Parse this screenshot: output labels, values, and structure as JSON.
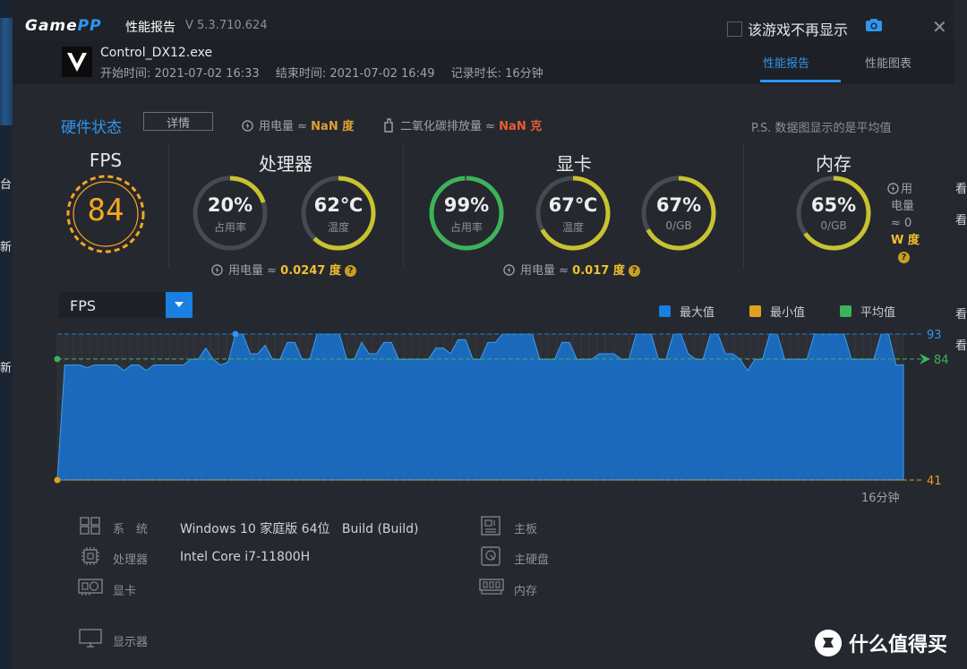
{
  "app": {
    "logo_game": "Game",
    "logo_pp": "PP",
    "title": "性能报告",
    "version": "V 5.3.710.624",
    "no_display_label": "该游戏不再显示",
    "close_glyph": "✕"
  },
  "session": {
    "exe": "Control_DX12.exe",
    "start": "开始时间: 2021-07-02 16:33",
    "end": "结束时间: 2021-07-02 16:49",
    "duration": "记录时长: 16分钟"
  },
  "tabs": [
    {
      "label": "性能报告",
      "active": true
    },
    {
      "label": "性能图表",
      "active": false
    }
  ],
  "hardware": {
    "title": "硬件状态",
    "detail_button": "详情",
    "power_label": "用电量 ≈",
    "power_value": "NaN 度",
    "co2_label": "二氧化碳排放量 ≈",
    "co2_value": "NaN 克",
    "note": "P.S. 数据图显示的是平均值"
  },
  "sections": {
    "fps": {
      "title": "FPS",
      "value": "84"
    },
    "cpu": {
      "title": "处理器",
      "usage": {
        "value": "20%",
        "label": "占用率",
        "fraction": 0.2,
        "color": "#c8c230"
      },
      "temp": {
        "value": "62℃",
        "label": "温度",
        "fraction": 0.62,
        "color": "#c8c230"
      },
      "power_label": "用电量 ≈",
      "power_value": "0.0247 度"
    },
    "gpu": {
      "title": "显卡",
      "usage": {
        "value": "99%",
        "label": "占用率",
        "fraction": 0.99,
        "color": "#3cb35a"
      },
      "temp": {
        "value": "67℃",
        "label": "温度",
        "fraction": 0.67,
        "color": "#c8c230"
      },
      "vram": {
        "value": "67%",
        "label": "0/GB",
        "fraction": 0.67,
        "color": "#c8c230"
      },
      "power_label": "用电量 ≈",
      "power_value": "0.017 度"
    },
    "mem": {
      "title": "内存",
      "usage": {
        "value": "65%",
        "label": "0/GB",
        "fraction": 0.65,
        "color": "#c8c230"
      },
      "power_l1": "用",
      "power_l2": "电量",
      "power_l3": "≈ 0",
      "power_l4": "W 度"
    }
  },
  "chart_controls": {
    "metric_selected": "FPS",
    "legend": [
      {
        "name": "最大值",
        "color": "#1a7fe0"
      },
      {
        "name": "最小值",
        "color": "#e0a020"
      },
      {
        "name": "平均值",
        "color": "#3cb35a"
      }
    ],
    "elapsed_label": "16分钟"
  },
  "chart_data": {
    "type": "area",
    "title": "",
    "xlabel": "",
    "ylabel": "",
    "max": 93,
    "min": 41,
    "avg": 84.09,
    "max_label": "93",
    "min_label": "41",
    "avg_label": "84.09",
    "series": [
      {
        "name": "FPS",
        "values": [
          41,
          82,
          82,
          82,
          81,
          82,
          82,
          82,
          82,
          80,
          82,
          82,
          80,
          82,
          82,
          82,
          82,
          82,
          84,
          84,
          88,
          84,
          82,
          83,
          93,
          93,
          86,
          86,
          89,
          84,
          84,
          90,
          90,
          84,
          84,
          93,
          93,
          93,
          93,
          84,
          84,
          90,
          86,
          86,
          90,
          90,
          84,
          84,
          84,
          84,
          84,
          88,
          88,
          86,
          91,
          91,
          84,
          84,
          90,
          90,
          93,
          93,
          93,
          93,
          93,
          84,
          84,
          84,
          90,
          90,
          84,
          84,
          84,
          86,
          86,
          86,
          84,
          84,
          93,
          93,
          93,
          84,
          84,
          93,
          93,
          86,
          84,
          84,
          93,
          93,
          86,
          86,
          84,
          80,
          84,
          84,
          93,
          93,
          84,
          84,
          84,
          84,
          93,
          93,
          93,
          93,
          93,
          84,
          84,
          84,
          84,
          93,
          93,
          82,
          82
        ]
      }
    ],
    "ylim": [
      41,
      93
    ],
    "grid": true,
    "legend_position": "top-right"
  },
  "system": {
    "os_label": "系　统",
    "os_value": "Windows 10 家庭版 64位",
    "os_build": "Build (Build)",
    "cpu_label": "处理器",
    "cpu_value": "Intel Core i7-11800H",
    "gpu_label": "显卡",
    "board_label": "主板",
    "disk_label": "主硬盘",
    "memory_label": "内存",
    "monitor_label": "显示器"
  },
  "background": {
    "left_chars": [
      "台",
      "新",
      "新"
    ],
    "right_chars": [
      "看",
      "看",
      "看",
      "看"
    ]
  },
  "watermark": {
    "text": "什么值得买"
  },
  "colors": {
    "accent": "#2f95f0",
    "chart_fill": "#1a6fc8",
    "avg_line": "#3cb35a",
    "min_line": "#e0a020"
  }
}
